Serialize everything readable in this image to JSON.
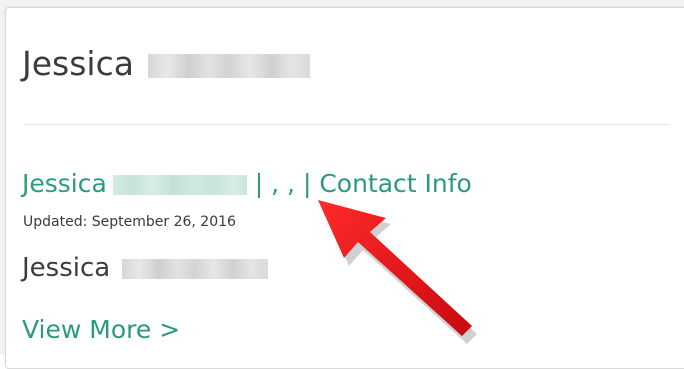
{
  "profile": {
    "title_first_name": "Jessica",
    "link_first_name": "Jessica",
    "separators": "| , , |",
    "contact_link": "Contact Info",
    "updated_text": "Updated: September 26, 2016",
    "subname_first_name": "Jessica",
    "view_more": "View More >"
  },
  "colors": {
    "link": "#2d9a7d",
    "text": "#3c3c3c",
    "arrow": "#e8141b"
  },
  "icons": {
    "annotation": "red-arrow"
  }
}
